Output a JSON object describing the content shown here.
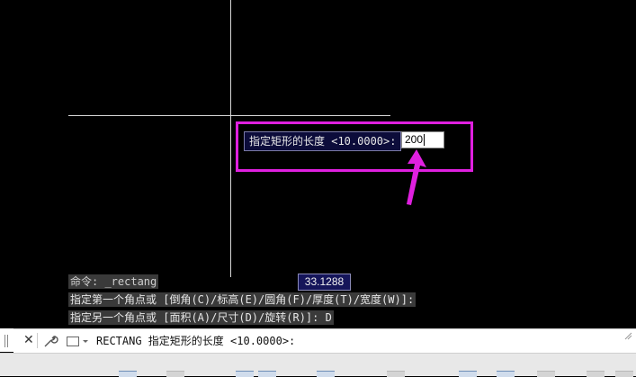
{
  "dynamic_input": {
    "prompt": "指定矩形的长度 <10.0000>:",
    "value": "200"
  },
  "coordinate_tooltip": "33.1288",
  "command_history": [
    "命令: _rectang",
    "指定第一个角点或 [倒角(C)/标高(E)/圆角(F)/厚度(T)/宽度(W)]:",
    "指定另一个角点或 [面积(A)/尺寸(D)/旋转(R)]: D"
  ],
  "command_line": {
    "text": "RECTANG 指定矩形的长度 <10.0000>:",
    "close_icon": "close-icon",
    "customize_icon": "wrench-icon",
    "recent_icon": "command-dropdown-icon"
  },
  "colors": {
    "highlight": "#e020e0",
    "canvas": "#000000",
    "prompt_bg": "#0c0c3a"
  }
}
